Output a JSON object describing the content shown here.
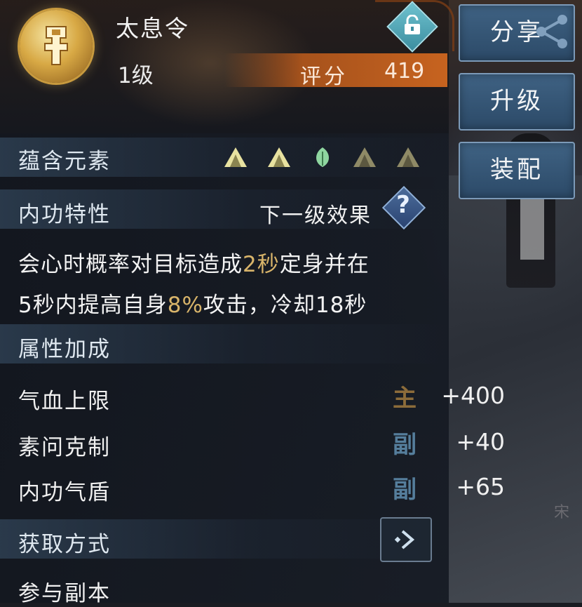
{
  "item": {
    "name": "太息令",
    "level": "1级",
    "score_label": "评分",
    "score_value": "419"
  },
  "elements": {
    "label": "蕴含元素",
    "icons": [
      "triangle-icon",
      "triangle-icon",
      "leaf-icon",
      "triangle-icon",
      "triangle-icon"
    ]
  },
  "trait": {
    "label": "内功特性",
    "next_level_label": "下一级效果",
    "desc_line1_a": "会心时概率对目标造成",
    "desc_line1_hl": "2秒",
    "desc_line1_b": "定身并在",
    "desc_line2_a": "5秒内提高自身",
    "desc_line2_hl": "8%",
    "desc_line2_b": "攻击，冷却18秒"
  },
  "attributes": {
    "label": "属性加成",
    "rows": [
      {
        "name": "气血上限",
        "value": "+400",
        "tag": "主"
      },
      {
        "name": "素问克制",
        "value": "+40",
        "tag": "副"
      },
      {
        "name": "内功气盾",
        "value": "+65",
        "tag": "副"
      }
    ]
  },
  "acquire": {
    "label": "获取方式",
    "first_source": "参与副本"
  },
  "side_buttons": {
    "share": "分享",
    "upgrade": "升级",
    "equip": "装配"
  },
  "background_text": "宋",
  "colors": {
    "highlight": "#d8b46a",
    "score_bar": "#c7631f",
    "tag_main": "#8c6c3a",
    "tag_sub": "#557e9c",
    "button": "#3f6283"
  }
}
